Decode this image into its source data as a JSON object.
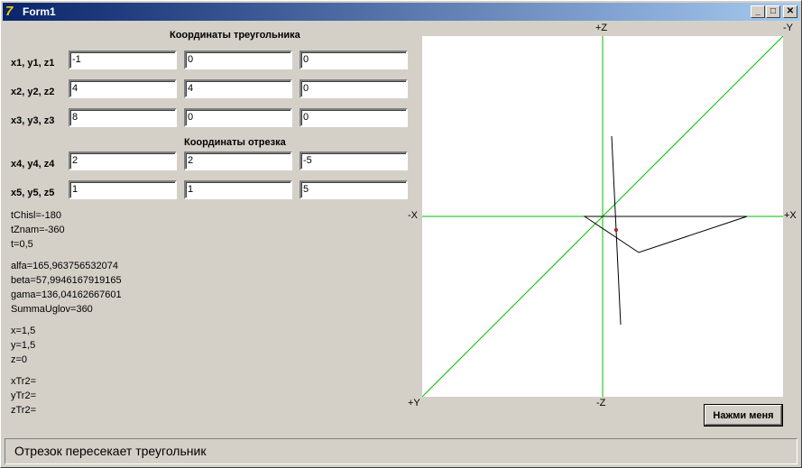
{
  "window": {
    "title": "Form1",
    "minimize": "_",
    "maximize": "□",
    "close": "✕"
  },
  "triangle_header": "Координаты треугольника",
  "segment_header": "Координаты отрезка",
  "rows": [
    {
      "label": "x1, y1, z1",
      "values": [
        "-1",
        "0",
        "0"
      ]
    },
    {
      "label": "x2, y2, z2",
      "values": [
        "4",
        "4",
        "0"
      ]
    },
    {
      "label": "x3, y3, z3",
      "values": [
        "8",
        "0",
        "0"
      ]
    },
    {
      "label": "x4, y4, z4",
      "values": [
        "2",
        "2",
        "-5"
      ]
    },
    {
      "label": "x5, y5, z5",
      "values": [
        "1",
        "1",
        "5"
      ]
    }
  ],
  "output": {
    "g1": [
      "tChisl=-180",
      "tZnam=-360",
      "t=0,5"
    ],
    "g2": [
      "alfa=165,963756532074",
      "beta=57,9946167919165",
      "gama=136,04162667601",
      "SummaUglov=360"
    ],
    "g3": [
      "x=1,5",
      "y=1,5",
      "z=0"
    ],
    "g4": [
      "xTr2=",
      "yTr2=",
      "zTr2="
    ]
  },
  "axes": {
    "pz": "+Z",
    "my": "-Y",
    "mx": "-X",
    "px": "+X",
    "py": "+Y",
    "mz": "-Z"
  },
  "button": "Нажми меня",
  "status": "Отрезок пересекает треугольник",
  "colors": {
    "axis": "#00c000",
    "shape": "#000000",
    "point": "#c00000"
  }
}
